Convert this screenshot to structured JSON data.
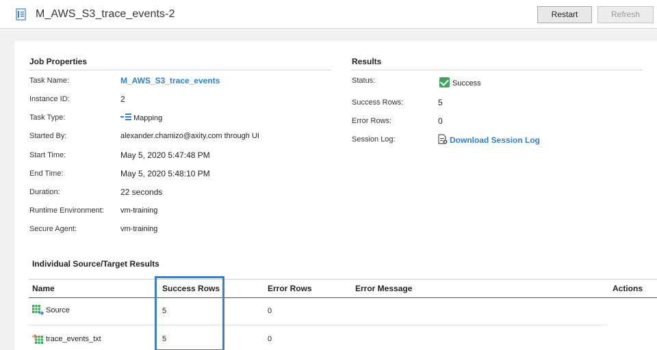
{
  "header": {
    "title": "M_AWS_S3_trace_events-2",
    "restart_label": "Restart",
    "refresh_label": "Refresh"
  },
  "job": {
    "section_title": "Job Properties",
    "task_name_label": "Task Name:",
    "task_name": "M_AWS_S3_trace_events",
    "instance_id_label": "Instance ID:",
    "instance_id": "2",
    "task_type_label": "Task Type:",
    "task_type": "Mapping",
    "started_by_label": "Started By:",
    "started_by": "alexander.chamizo@axity.com through UI",
    "start_time_label": "Start Time:",
    "start_time": "May 5, 2020 5:47:48 PM",
    "end_time_label": "End Time:",
    "end_time": "May 5, 2020 5:48:10 PM",
    "duration_label": "Duration:",
    "duration": "22 seconds",
    "runtime_env_label": "Runtime Environment:",
    "runtime_env": "vm-training",
    "secure_agent_label": "Secure Agent:",
    "secure_agent": "vm-training"
  },
  "results": {
    "section_title": "Results",
    "status_label": "Status:",
    "status": "Success",
    "success_rows_label": "Success Rows:",
    "success_rows": "5",
    "error_rows_label": "Error Rows:",
    "error_rows": "0",
    "session_log_label": "Session Log:",
    "session_log_link": "Download Session Log"
  },
  "table": {
    "section_title": "Individual Source/Target Results",
    "headers": {
      "name": "Name",
      "success_rows": "Success Rows",
      "error_rows": "Error Rows",
      "error_message": "Error Message",
      "actions": "Actions"
    },
    "rows": [
      {
        "name": "Source",
        "success_rows": "5",
        "error_rows": "0",
        "error_message": ""
      },
      {
        "name": "trace_events_txt",
        "success_rows": "5",
        "error_rows": "0",
        "error_message": ""
      }
    ]
  },
  "colors": {
    "link": "#2f7fd0",
    "success": "#3da85a",
    "highlight_box": "#3b7ec3"
  }
}
